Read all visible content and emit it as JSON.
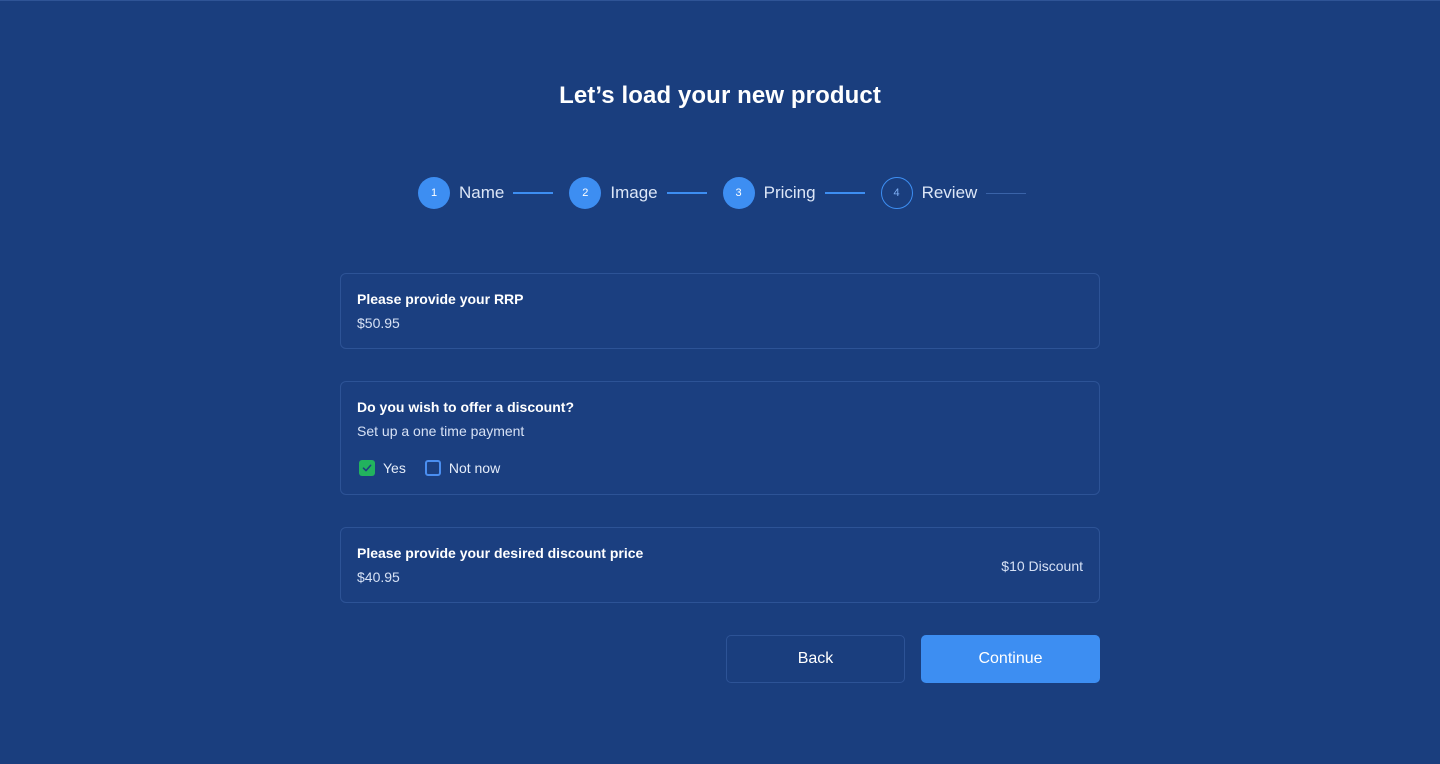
{
  "page": {
    "title": "Let’s load your new product"
  },
  "stepper": {
    "steps": [
      {
        "number": "1",
        "label": "Name",
        "state": "complete"
      },
      {
        "number": "2",
        "label": "Image",
        "state": "complete"
      },
      {
        "number": "3",
        "label": "Pricing",
        "state": "current"
      },
      {
        "number": "4",
        "label": "Review",
        "state": "upcoming"
      }
    ]
  },
  "rrp": {
    "heading": "Please provide your RRP",
    "value": "$50.95"
  },
  "discount": {
    "heading": "Do you wish to offer a discount?",
    "subtext": "Set up a one time payment",
    "options": [
      {
        "label": "Yes",
        "checked": true
      },
      {
        "label": "Not now",
        "checked": false
      }
    ]
  },
  "discount_price": {
    "heading": "Please provide your desired discount price",
    "value": "$40.95",
    "badge": "$10 Discount"
  },
  "actions": {
    "back_label": "Back",
    "continue_label": "Continue"
  },
  "colors": {
    "background": "#1a3e7e",
    "accent": "#3d8ef2",
    "checked": "#22b35e",
    "border": "#2d5396"
  },
  "icons": {
    "check": "check-icon"
  }
}
